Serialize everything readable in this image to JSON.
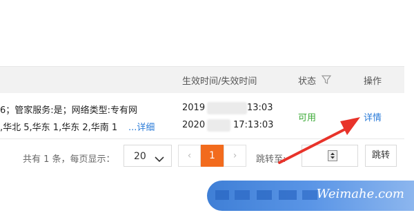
{
  "table": {
    "headers": {
      "time": "生效时间/失效时间",
      "status": "状态",
      "action": "操作"
    },
    "row": {
      "spec_line1": "6；管家服务:是；网络类型:专有网",
      "spec_line2": ",华北 5,华东 1,华东 2,华南 1",
      "detail_short": "...详细",
      "start_prefix": "2019",
      "start_suffix": "13:03",
      "end_prefix": "2020",
      "end_suffix": "17:13:03",
      "status": "可用",
      "detail_link": "详情"
    }
  },
  "pager": {
    "total_label": "共有 1 条，每页显示：",
    "page_size": "20",
    "prev": "‹",
    "current_page": "1",
    "next": "›",
    "jump_label": "跳转至:",
    "jump_button": "跳转"
  },
  "watermark": {
    "text": "Weimahe.com"
  },
  "colors": {
    "accent": "#f26b1d",
    "link": "#2a7bd8",
    "status_ok": "#3aa935",
    "arrow": "#e8332a"
  }
}
